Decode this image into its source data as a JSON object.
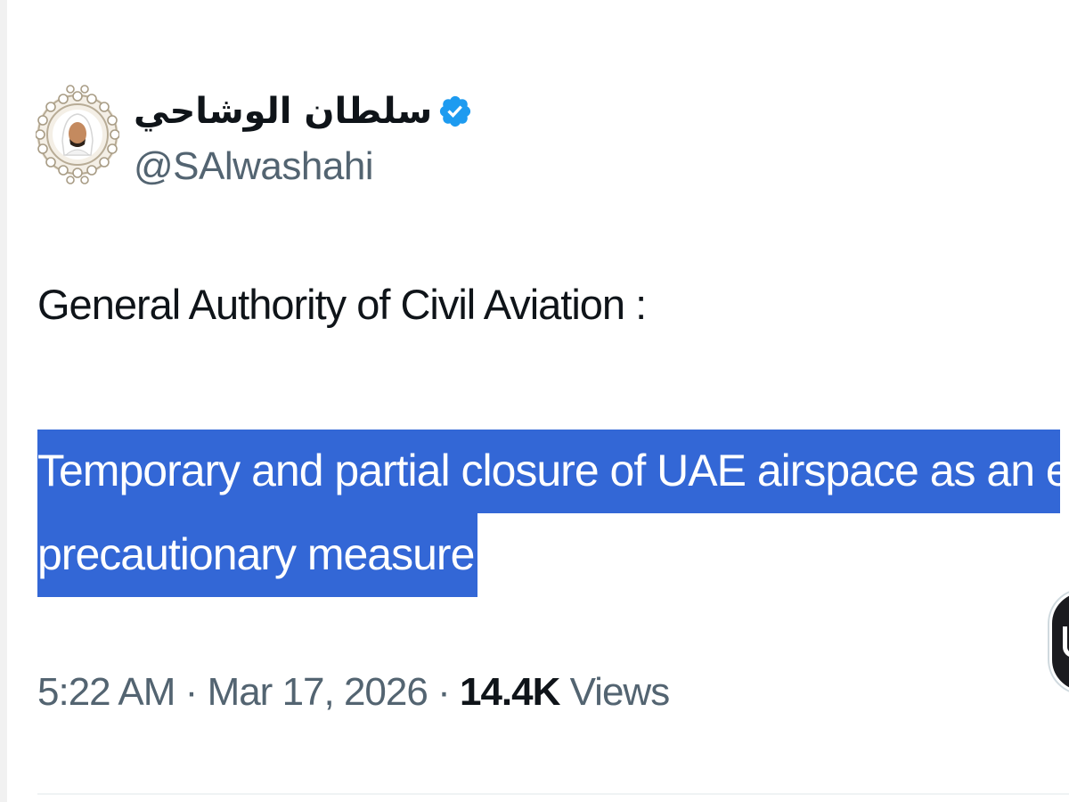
{
  "author": {
    "display_name": "سلطان الوشاحي",
    "handle": "@SAlwashahi",
    "verified": true,
    "avatar_icon": "profile-avatar-icon",
    "verified_icon": "verified-badge-icon"
  },
  "post": {
    "line1": "General Authority of Civil Aviation :",
    "highlighted_line1": "Temporary and partial closure of UAE airspace as an exceptional",
    "highlighted_line2": "precautionary measure"
  },
  "meta": {
    "time": "5:22 AM",
    "separator": "·",
    "date": "Mar 17, 2026",
    "views_count": "14.4K",
    "views_label": "Views"
  },
  "colors": {
    "highlight": "#3367d6",
    "verified": "#1d9bf0",
    "secondary_text": "#536471",
    "primary_text": "#0f1419"
  }
}
